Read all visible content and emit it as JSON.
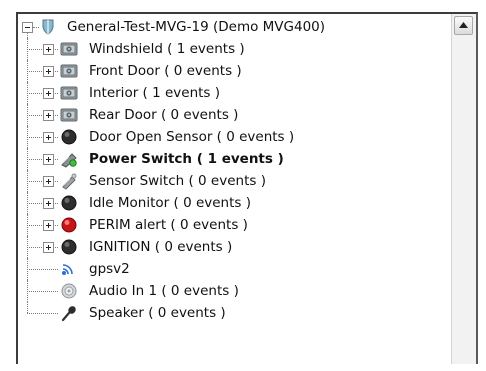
{
  "tree": {
    "root": {
      "label": "General-Test-MVG-19 (Demo MVG400)",
      "icon": "shield-icon"
    },
    "children": [
      {
        "label": "Windshield ( 1 events )",
        "icon": "camera-icon",
        "bold": false,
        "expandable": true
      },
      {
        "label": "Front Door ( 0 events )",
        "icon": "camera-icon",
        "bold": false,
        "expandable": true
      },
      {
        "label": "Interior ( 1 events )",
        "icon": "camera-icon",
        "bold": false,
        "expandable": true
      },
      {
        "label": "Rear Door ( 0 events )",
        "icon": "camera-icon",
        "bold": false,
        "expandable": true
      },
      {
        "label": "Door Open Sensor ( 0 events )",
        "icon": "sensor-dark-icon",
        "bold": false,
        "expandable": true
      },
      {
        "label": "Power Switch ( 1 events )",
        "icon": "switch-active-icon",
        "bold": true,
        "expandable": true
      },
      {
        "label": "Sensor Switch ( 0 events )",
        "icon": "switch-icon",
        "bold": false,
        "expandable": true
      },
      {
        "label": "Idle Monitor ( 0 events )",
        "icon": "sensor-dark-icon",
        "bold": false,
        "expandable": true
      },
      {
        "label": "PERIM alert ( 0 events )",
        "icon": "sensor-red-icon",
        "bold": false,
        "expandable": true
      },
      {
        "label": "IGNITION ( 0 events )",
        "icon": "sensor-dark-icon",
        "bold": false,
        "expandable": true
      },
      {
        "label": "gpsv2",
        "icon": "gps-icon",
        "bold": false,
        "expandable": false
      },
      {
        "label": "Audio In 1 ( 0 events )",
        "icon": "speaker-in-icon",
        "bold": false,
        "expandable": false
      },
      {
        "label": "Speaker ( 0 events )",
        "icon": "microphone-icon",
        "bold": false,
        "expandable": false
      }
    ]
  },
  "scrollbar": {
    "up_icon": "arrow-up-icon"
  }
}
